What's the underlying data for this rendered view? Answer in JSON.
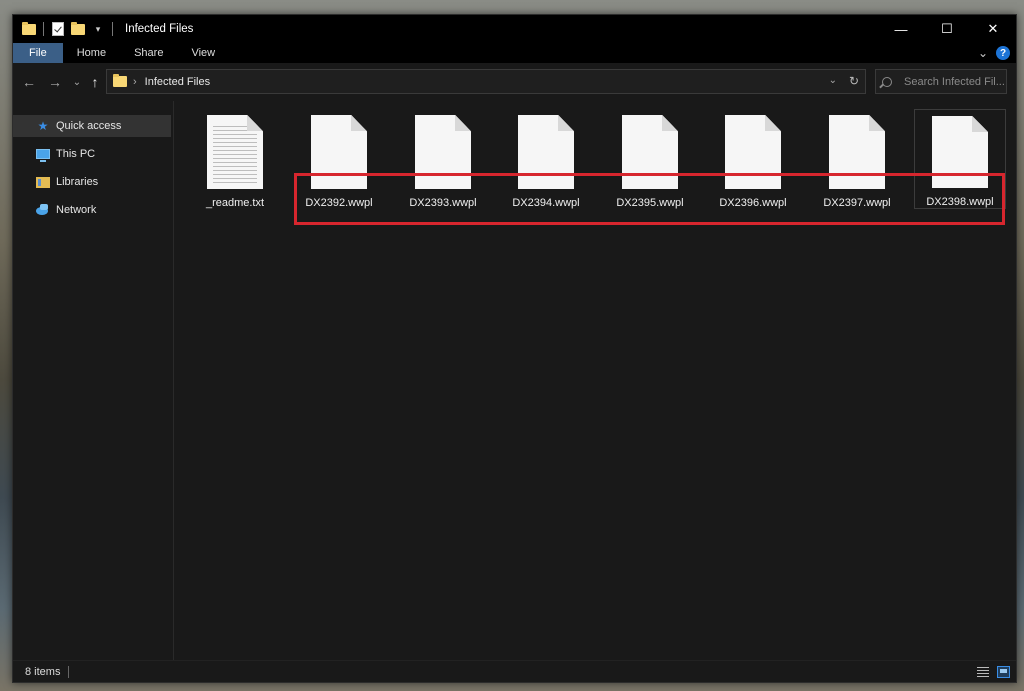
{
  "window": {
    "title": "Infected Files",
    "minimize": "—",
    "maximize": "☐",
    "close": "✕"
  },
  "ribbon": {
    "tabs": [
      "File",
      "Home",
      "Share",
      "View"
    ],
    "expand": "⌄",
    "help": "?"
  },
  "address": {
    "back": "←",
    "forward": "→",
    "recent": "⌄",
    "up": "↑",
    "separator": "›",
    "current": "Infected Files",
    "dropdown": "⌄",
    "refresh": "↻"
  },
  "search": {
    "placeholder": "Search Infected Fil..."
  },
  "sidebar": {
    "items": [
      {
        "label": "Quick access",
        "icon": "star-icon"
      },
      {
        "label": "This PC",
        "icon": "computer-icon"
      },
      {
        "label": "Libraries",
        "icon": "libraries-icon"
      },
      {
        "label": "Network",
        "icon": "network-icon"
      }
    ]
  },
  "files": [
    {
      "name": "_readme.txt",
      "type": "text"
    },
    {
      "name": "DX2392.wwpl",
      "type": "blank"
    },
    {
      "name": "DX2393.wwpl",
      "type": "blank"
    },
    {
      "name": "DX2394.wwpl",
      "type": "blank"
    },
    {
      "name": "DX2395.wwpl",
      "type": "blank"
    },
    {
      "name": "DX2396.wwpl",
      "type": "blank"
    },
    {
      "name": "DX2397.wwpl",
      "type": "blank"
    },
    {
      "name": "DX2398.wwpl",
      "type": "blank"
    }
  ],
  "status": {
    "item_count": "8 items"
  },
  "colors": {
    "highlight_box": "#d7262e",
    "file_tab": "#3b5f87",
    "accent": "#3a8ee6"
  }
}
